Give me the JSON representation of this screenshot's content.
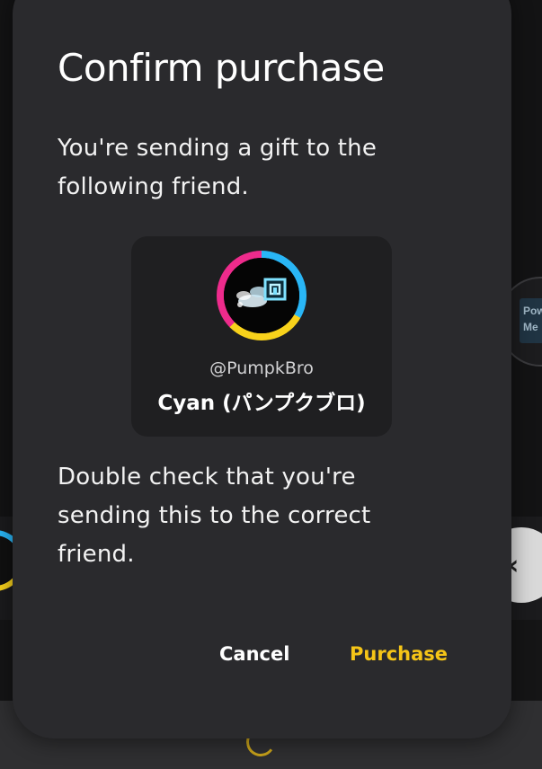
{
  "background": {
    "right_card_text": "Pow\nMe",
    "right_button_icon": "chevron-left-icon",
    "spinner_icon": "loading-spinner-icon"
  },
  "dialog": {
    "title": "Confirm purchase",
    "message": "You're sending a gift to the following friend.",
    "warning": "Double check that you're sending this to the correct friend.",
    "friend": {
      "avatar_icon": "avatar",
      "avatar_ring_colors": [
        "#29b6f6",
        "#f8d21b",
        "#ee2b8c"
      ],
      "handle": "@PumpkBro",
      "name": "Cyan (パンプクブロ)"
    },
    "buttons": {
      "cancel_label": "Cancel",
      "purchase_label": "Purchase"
    },
    "colors": {
      "surface": "#2a2a2d",
      "card": "#1f1f21",
      "accent": "#f5c517"
    }
  }
}
